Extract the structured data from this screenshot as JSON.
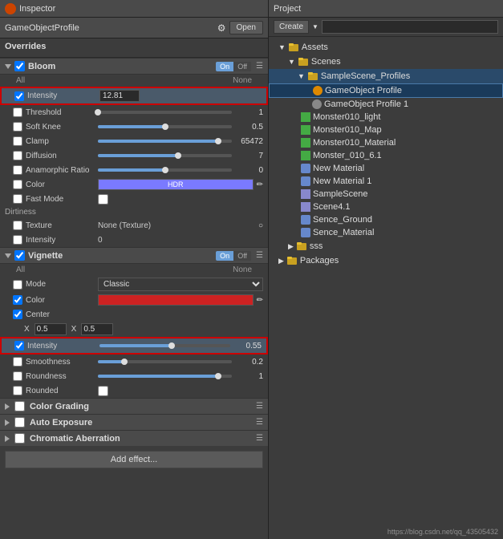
{
  "inspector": {
    "title": "Inspector",
    "go_profile_title": "GameObjectProfile",
    "open_btn": "Open",
    "overrides_title": "Overrides",
    "bloom": {
      "name": "Bloom",
      "toggle_on": "On",
      "toggle_off": "Off",
      "all_label": "All",
      "none_label": "None",
      "properties": [
        {
          "id": "intensity",
          "label": "Intensity",
          "checked": true,
          "value": "12.81",
          "highlighted": true
        },
        {
          "id": "threshold",
          "label": "Threshold",
          "checked": false,
          "value": "1",
          "slider_pct": 0
        },
        {
          "id": "soft_knee",
          "label": "Soft Knee",
          "checked": false,
          "value": "0.5",
          "slider_pct": 50
        },
        {
          "id": "clamp",
          "label": "Clamp",
          "checked": false,
          "value": "65472",
          "slider_pct": 90
        },
        {
          "id": "diffusion",
          "label": "Diffusion",
          "checked": false,
          "value": "7",
          "slider_pct": 60
        },
        {
          "id": "anamorphic",
          "label": "Anamorphic Ratio",
          "checked": false,
          "value": "0",
          "slider_pct": 50
        },
        {
          "id": "color",
          "label": "Color",
          "checked": false,
          "type": "color",
          "color": "hdr"
        },
        {
          "id": "fast_mode",
          "label": "Fast Mode",
          "checked": false,
          "type": "checkbox_only"
        }
      ]
    },
    "dirtiness": {
      "name": "Dirtiness",
      "properties": [
        {
          "id": "texture",
          "label": "Texture",
          "value": "None (Texture)"
        },
        {
          "id": "intensity",
          "label": "Intensity",
          "value": "0"
        }
      ]
    },
    "vignette": {
      "name": "Vignette",
      "toggle_on": "On",
      "toggle_off": "Off",
      "all_label": "All",
      "none_label": "None",
      "properties": [
        {
          "id": "mode",
          "label": "Mode",
          "value": "Classic"
        },
        {
          "id": "color",
          "label": "Color",
          "checked": true,
          "type": "color_red"
        },
        {
          "id": "center",
          "label": "Center",
          "checked": true
        },
        {
          "id": "center_x",
          "x": "0.5",
          "y": "0.5"
        },
        {
          "id": "intensity",
          "label": "Intensity",
          "checked": true,
          "value": "0.55",
          "slider_pct": 55,
          "highlighted": true
        },
        {
          "id": "smoothness",
          "label": "Smoothness",
          "checked": false,
          "value": "0.2",
          "slider_pct": 20
        },
        {
          "id": "roundness",
          "label": "Roundness",
          "checked": false,
          "value": "1",
          "slider_pct": 90
        },
        {
          "id": "rounded",
          "label": "Rounded",
          "checked": false,
          "type": "checkbox_only"
        }
      ]
    },
    "color_grading": {
      "name": "Color Grading"
    },
    "auto_exposure": {
      "name": "Auto Exposure"
    },
    "chromatic": {
      "name": "Chromatic Aberration"
    },
    "add_effect_btn": "Add effect..."
  },
  "project": {
    "title": "Project",
    "create_btn": "Create",
    "tree": [
      {
        "id": "assets",
        "label": "Assets",
        "indent": 0,
        "type": "folder",
        "open": true
      },
      {
        "id": "scenes",
        "label": "Scenes",
        "indent": 1,
        "type": "folder",
        "open": true
      },
      {
        "id": "samplescene_profiles",
        "label": "SampleScene_Profiles",
        "indent": 2,
        "type": "folder",
        "selected": true
      },
      {
        "id": "gameobject_profile",
        "label": "GameObject Profile",
        "indent": 3,
        "type": "asset",
        "highlighted": true
      },
      {
        "id": "gameobject_profile_1",
        "label": "GameObject Profile 1",
        "indent": 3,
        "type": "asset"
      },
      {
        "id": "monster010_light",
        "label": "Monster010_light",
        "indent": 2,
        "type": "asset"
      },
      {
        "id": "monster010_map",
        "label": "Monster010_Map",
        "indent": 2,
        "type": "asset"
      },
      {
        "id": "monster010_material",
        "label": "Monster010_Material",
        "indent": 2,
        "type": "asset"
      },
      {
        "id": "monster_010_6",
        "label": "Monster_010_6.1",
        "indent": 2,
        "type": "asset"
      },
      {
        "id": "new_material",
        "label": "New Material",
        "indent": 2,
        "type": "asset"
      },
      {
        "id": "new_material_1",
        "label": "New Material 1",
        "indent": 2,
        "type": "asset"
      },
      {
        "id": "samplescene",
        "label": "SampleScene",
        "indent": 2,
        "type": "asset"
      },
      {
        "id": "scene4",
        "label": "Scene4.1",
        "indent": 2,
        "type": "asset"
      },
      {
        "id": "sence_ground",
        "label": "Sence_Ground",
        "indent": 2,
        "type": "asset"
      },
      {
        "id": "sence_material",
        "label": "Sence_Material",
        "indent": 2,
        "type": "asset"
      },
      {
        "id": "sss",
        "label": "sss",
        "indent": 1,
        "type": "folder"
      },
      {
        "id": "packages",
        "label": "Packages",
        "indent": 0,
        "type": "folder"
      }
    ]
  },
  "watermark": "https://blog.csdn.net/qq_43505432"
}
